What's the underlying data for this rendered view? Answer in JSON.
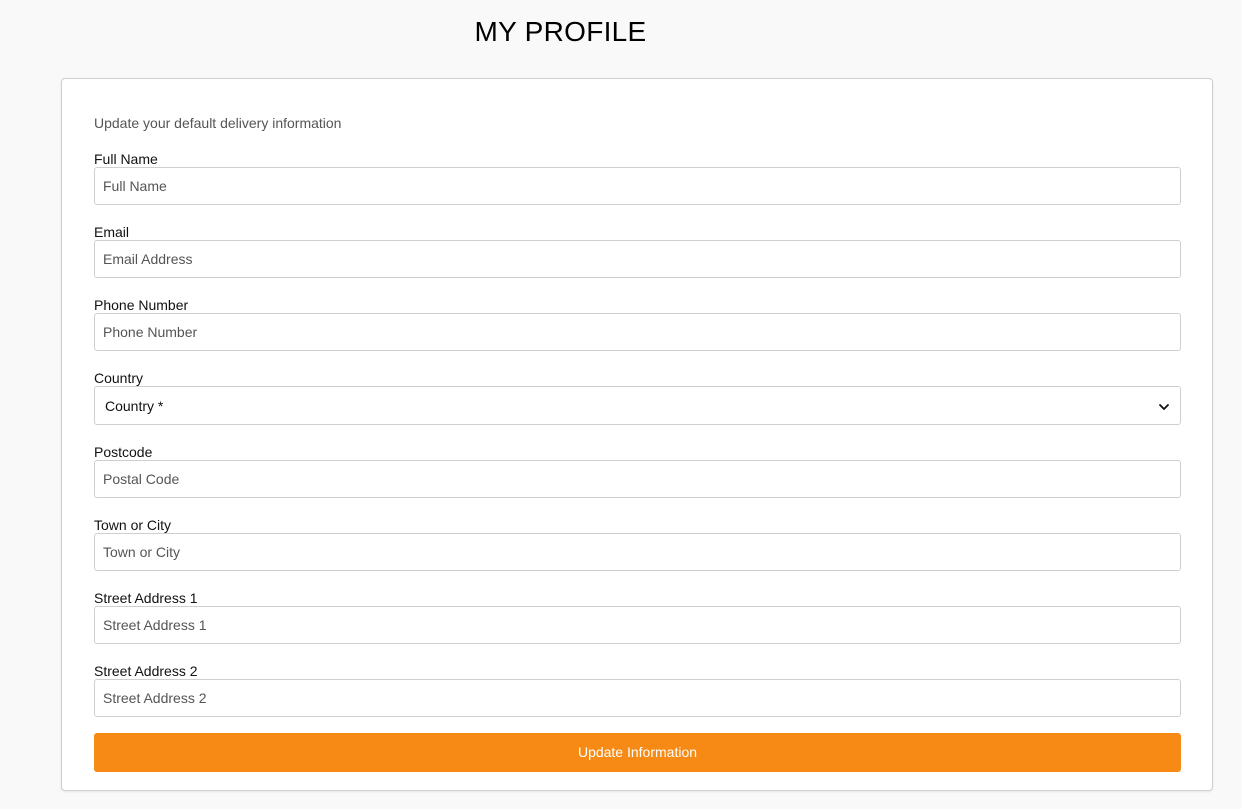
{
  "page": {
    "title": "MY PROFILE"
  },
  "form": {
    "intro": "Update your default delivery information",
    "fields": {
      "full_name": {
        "label": "Full Name",
        "placeholder": "Full Name",
        "value": ""
      },
      "email": {
        "label": "Email",
        "placeholder": "Email Address",
        "value": ""
      },
      "phone": {
        "label": "Phone Number",
        "placeholder": "Phone Number",
        "value": ""
      },
      "country": {
        "label": "Country",
        "selected": "Country *",
        "icon": "chevron-down-icon"
      },
      "postcode": {
        "label": "Postcode",
        "placeholder": "Postal Code",
        "value": ""
      },
      "town": {
        "label": "Town or City",
        "placeholder": "Town or City",
        "value": ""
      },
      "street1": {
        "label": "Street Address 1",
        "placeholder": "Street Address 1",
        "value": ""
      },
      "street2": {
        "label": "Street Address 2",
        "placeholder": "Street Address 2",
        "value": ""
      }
    },
    "submit_label": "Update Information"
  },
  "colors": {
    "accent": "#f78a14",
    "background": "#f9f9f9",
    "card": "#ffffff",
    "border": "#cfcfcf"
  }
}
